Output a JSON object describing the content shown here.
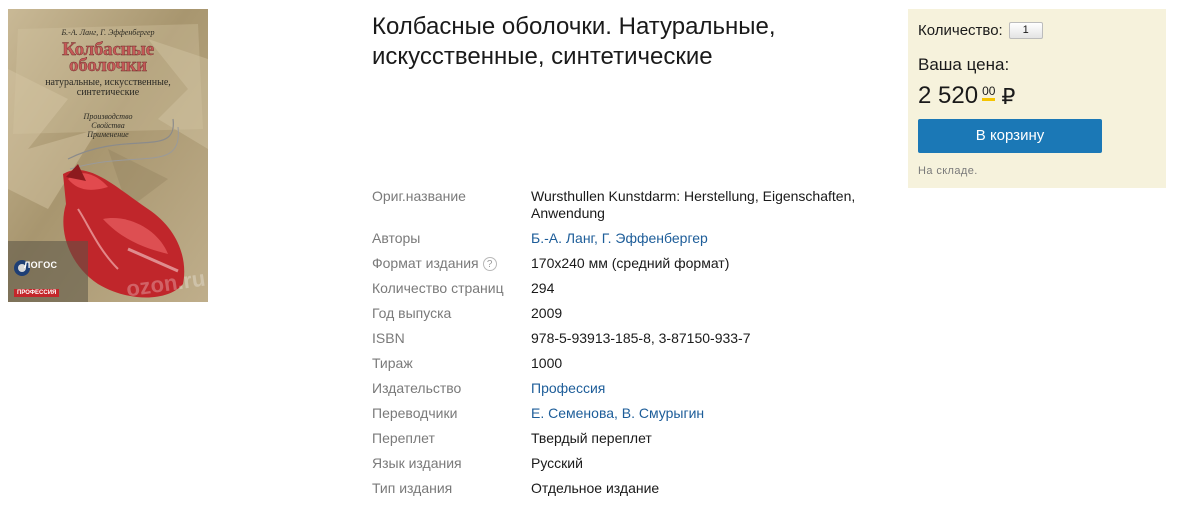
{
  "cover": {
    "authors_line": "Б.-А. Ланг, Г. Эффенбергер",
    "title_line1": "Колбасные",
    "title_line2": "оболочки",
    "subtitle_line1": "натуральные, искусственные,",
    "subtitle_line2": "синтетические",
    "tag_line1": "Производство",
    "tag_line2": "Свойства",
    "tag_line3": "Применение",
    "publisher_logo": "ЛОГОС",
    "series": "ПРОФЕССИЯ",
    "watermark": "ozon.ru"
  },
  "title": "Колбасные оболочки. Натуральные, искусственные, синтетические",
  "specs": [
    {
      "label": "Ориг.название",
      "value": "Wursthullen Kunstdarm: Herstellung, Eigenschaften, Anwendung"
    },
    {
      "label": "Авторы",
      "value": "Б.-А. Ланг, Г. Эффенбергер"
    },
    {
      "label": "Формат издания",
      "value": "170х240 мм (средний формат)",
      "help": "?"
    },
    {
      "label": "Количество страниц",
      "value": "294"
    },
    {
      "label": "Год выпуска",
      "value": "2009"
    },
    {
      "label": "ISBN",
      "value": "978-5-93913-185-8, 3-87150-933-7"
    },
    {
      "label": "Тираж",
      "value": "1000"
    },
    {
      "label": "Издательство",
      "value": "Профессия"
    },
    {
      "label": "Переводчики",
      "value": "Е. Семенова, В. Смурыгин"
    },
    {
      "label": "Переплет",
      "value": "Твердый переплет"
    },
    {
      "label": "Язык издания",
      "value": "Русский"
    },
    {
      "label": "Тип издания",
      "value": "Отдельное издание"
    }
  ],
  "buy": {
    "qty_label": "Количество:",
    "qty_value": "1",
    "price_label": "Ваша цена:",
    "price_amount": "2 520",
    "price_cents": "00",
    "currency": "₽",
    "cart_button": "В корзину",
    "stock": "На складе."
  },
  "colors": {
    "link": "#1d5d99",
    "cart_button": "#1b78b6",
    "buybox_bg": "#f6f2dc",
    "price_underline": "#f5c400"
  }
}
